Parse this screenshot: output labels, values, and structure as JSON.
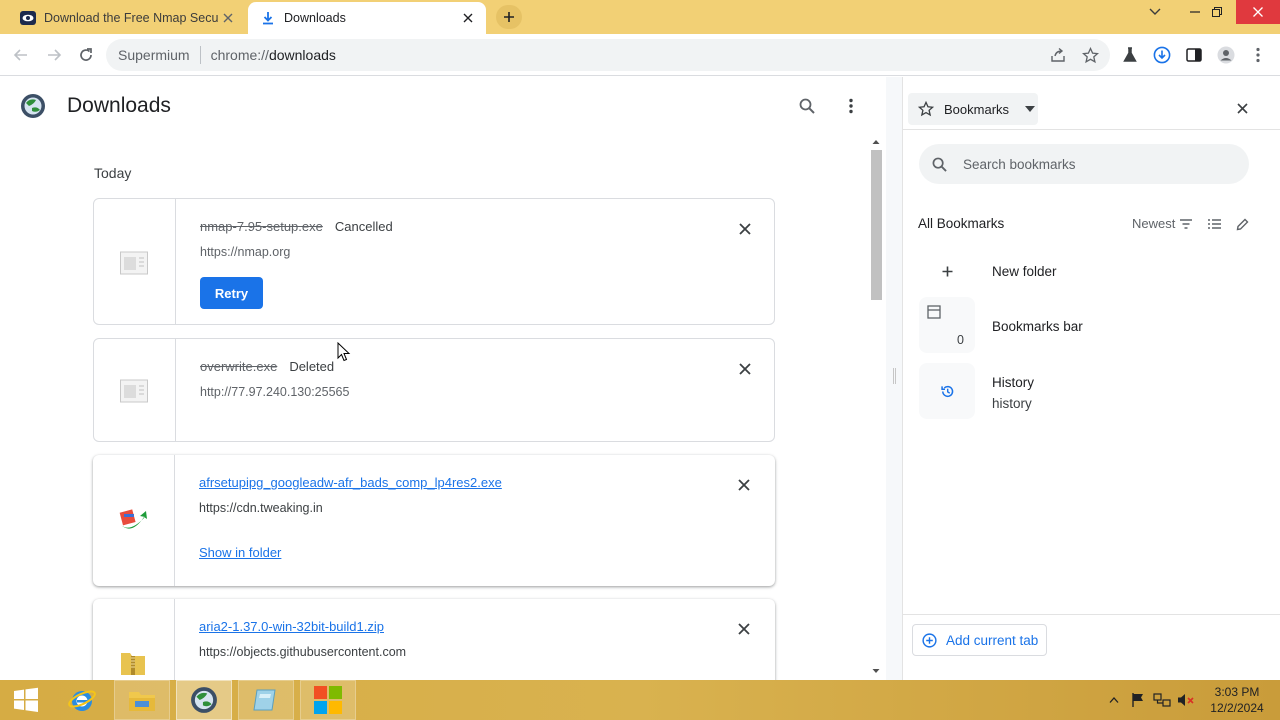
{
  "browser": {
    "tabs": [
      {
        "title": "Download the Free Nmap Security Scanner",
        "active": false
      },
      {
        "title": "Downloads",
        "active": true
      }
    ],
    "omnibox": {
      "site_label": "Supermium",
      "url_scheme": "chrome://",
      "url_path": "downloads"
    }
  },
  "downloads": {
    "page_title": "Downloads",
    "section_date": "Today",
    "items": [
      {
        "filename": "nmap-7.95-setup.exe",
        "status": "Cancelled",
        "url": "https://nmap.org",
        "action": "Retry"
      },
      {
        "filename": "overwrite.exe",
        "status": "Deleted",
        "url": "http://77.97.240.130:25565",
        "action": ""
      },
      {
        "filename": "afrsetupipg_googleadw-afr_bads_comp_lp4res2.exe",
        "status": "",
        "url": "https://cdn.tweaking.in",
        "action": "Show in folder"
      },
      {
        "filename": "aria2-1.37.0-win-32bit-build1.zip",
        "status": "",
        "url": "https://objects.githubusercontent.com",
        "action": ""
      }
    ]
  },
  "side_panel": {
    "selector_label": "Bookmarks",
    "search_placeholder": "Search bookmarks",
    "heading": "All Bookmarks",
    "sort_label": "Newest",
    "entries": [
      {
        "label": "New folder",
        "sub": "",
        "count": ""
      },
      {
        "label": "Bookmarks bar",
        "sub": "",
        "count": "0"
      },
      {
        "label": "History",
        "sub": "history",
        "count": ""
      }
    ],
    "footer_button": "Add current tab"
  },
  "taskbar": {
    "clock_time": "3:03 PM",
    "clock_date": "12/2/2024"
  },
  "colors": {
    "accent": "#1a73e8",
    "tabstrip": "#f2d075",
    "taskbar": "#d6ac44",
    "close_button": "#e0393e"
  }
}
